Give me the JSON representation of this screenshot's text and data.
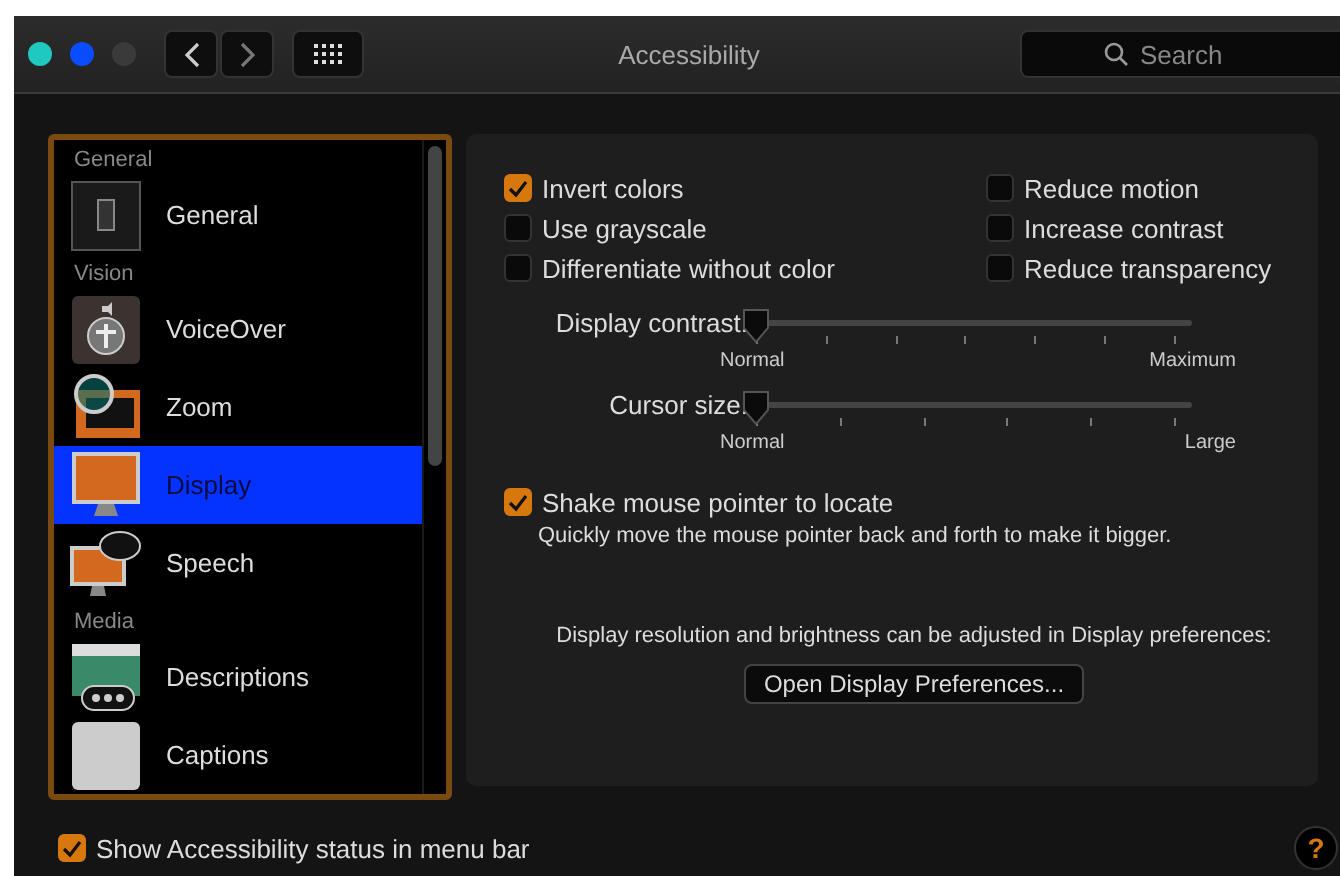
{
  "window": {
    "title": "Accessibility"
  },
  "search": {
    "placeholder": "Search"
  },
  "sidebar": {
    "sections": [
      {
        "header": "General",
        "items": [
          {
            "label": "General",
            "kind": "general",
            "selected": false
          }
        ]
      },
      {
        "header": "Vision",
        "items": [
          {
            "label": "VoiceOver",
            "kind": "voiceover",
            "selected": false
          },
          {
            "label": "Zoom",
            "kind": "zoom",
            "selected": false
          },
          {
            "label": "Display",
            "kind": "display",
            "selected": true
          },
          {
            "label": "Speech",
            "kind": "speech",
            "selected": false
          }
        ]
      },
      {
        "header": "Media",
        "items": [
          {
            "label": "Descriptions",
            "kind": "descriptions",
            "selected": false
          },
          {
            "label": "Captions",
            "kind": "captions",
            "selected": false
          }
        ]
      }
    ]
  },
  "options": {
    "left": [
      {
        "label": "Invert colors",
        "checked": true
      },
      {
        "label": "Use grayscale",
        "checked": false
      },
      {
        "label": "Differentiate without color",
        "checked": false
      }
    ],
    "right": [
      {
        "label": "Reduce motion",
        "checked": false
      },
      {
        "label": "Increase contrast",
        "checked": false
      },
      {
        "label": "Reduce transparency",
        "checked": false
      }
    ]
  },
  "sliders": [
    {
      "label": "Display contrast:",
      "kind": "contrast",
      "level": 0,
      "min_label": "Normal",
      "max_label": "Maximum"
    },
    {
      "label": "Cursor size:",
      "kind": "size",
      "level": 0,
      "min_label": "Normal",
      "max_label": "Large"
    }
  ],
  "shake": {
    "label": "Shake mouse pointer to locate",
    "checked": true,
    "description": "Quickly move the mouse pointer back and forth to make it bigger."
  },
  "display_note": "Display resolution and brightness can be adjusted in Display preferences:",
  "open_button": "Open Display Preferences...",
  "footer": {
    "label": "Show Accessibility status in menu bar",
    "checked": true
  },
  "help": "?"
}
